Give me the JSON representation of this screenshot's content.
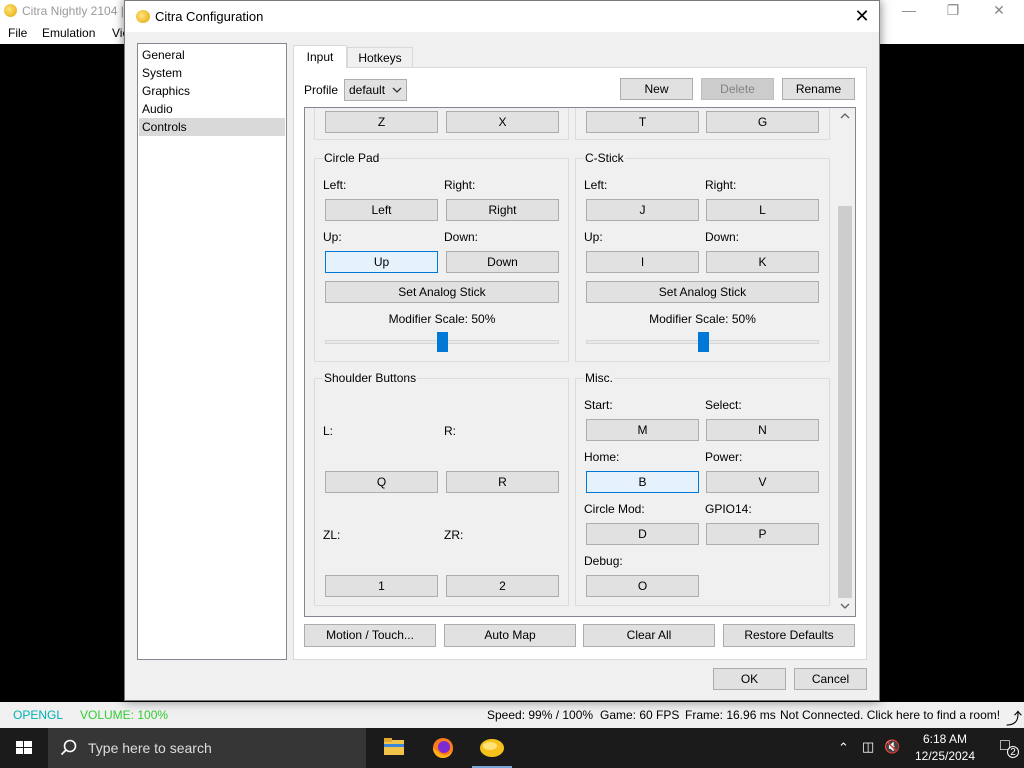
{
  "main_window": {
    "title": "Citra Nightly 2104 |",
    "menu": [
      "File",
      "Emulation",
      "Vie"
    ],
    "status": {
      "renderer": "OPENGL",
      "volume": "VOLUME: 100%",
      "speed": "Speed: 99% / 100%",
      "game_fps": "Game: 60 FPS",
      "frame": "Frame: 16.96 ms",
      "room": "Not Connected. Click here to find a room!"
    },
    "colors": {
      "renderer": "#00b3b3",
      "volume": "#33cc33"
    }
  },
  "dialog": {
    "title": "Citra Configuration",
    "categories": [
      "General",
      "System",
      "Graphics",
      "Audio",
      "Controls"
    ],
    "selected_category": "Controls",
    "tabs": [
      "Input",
      "Hotkeys"
    ],
    "profile_label": "Profile",
    "profile_value": "default",
    "profile_buttons": {
      "new": "New",
      "delete": "Delete",
      "rename": "Rename"
    },
    "top_row": {
      "z": "Z",
      "x": "X",
      "t": "T",
      "g": "G"
    },
    "circle_pad": {
      "title": "Circle Pad",
      "left_label": "Left:",
      "left": "Left",
      "right_label": "Right:",
      "right": "Right",
      "up_label": "Up:",
      "up": "Up",
      "down_label": "Down:",
      "down": "Down",
      "analog": "Set Analog Stick",
      "modifier": "Modifier Scale: 50%",
      "modifier_value": 50
    },
    "c_stick": {
      "title": "C-Stick",
      "left_label": "Left:",
      "left": "J",
      "right_label": "Right:",
      "right": "L",
      "up_label": "Up:",
      "up": "I",
      "down_label": "Down:",
      "down": "K",
      "analog": "Set Analog Stick",
      "modifier": "Modifier Scale: 50%",
      "modifier_value": 50
    },
    "shoulder": {
      "title": "Shoulder Buttons",
      "l_label": "L:",
      "l": "Q",
      "r_label": "R:",
      "r": "R",
      "zl_label": "ZL:",
      "zl": "1",
      "zr_label": "ZR:",
      "zr": "2"
    },
    "misc": {
      "title": "Misc.",
      "start_label": "Start:",
      "start": "M",
      "select_label": "Select:",
      "select": "N",
      "home_label": "Home:",
      "home": "B",
      "power_label": "Power:",
      "power": "V",
      "circlemod_label": "Circle Mod:",
      "circlemod": "D",
      "gpio14_label": "GPIO14:",
      "gpio14": "P",
      "debug_label": "Debug:",
      "debug": "O"
    },
    "bottom_buttons": {
      "motion": "Motion / Touch...",
      "automap": "Auto Map",
      "clear_all": "Clear All",
      "restore": "Restore Defaults"
    },
    "ok": "OK",
    "cancel": "Cancel"
  },
  "taskbar": {
    "search_placeholder": "Type here to search",
    "time": "6:18 AM",
    "date": "12/25/2024",
    "notifications": "2"
  }
}
